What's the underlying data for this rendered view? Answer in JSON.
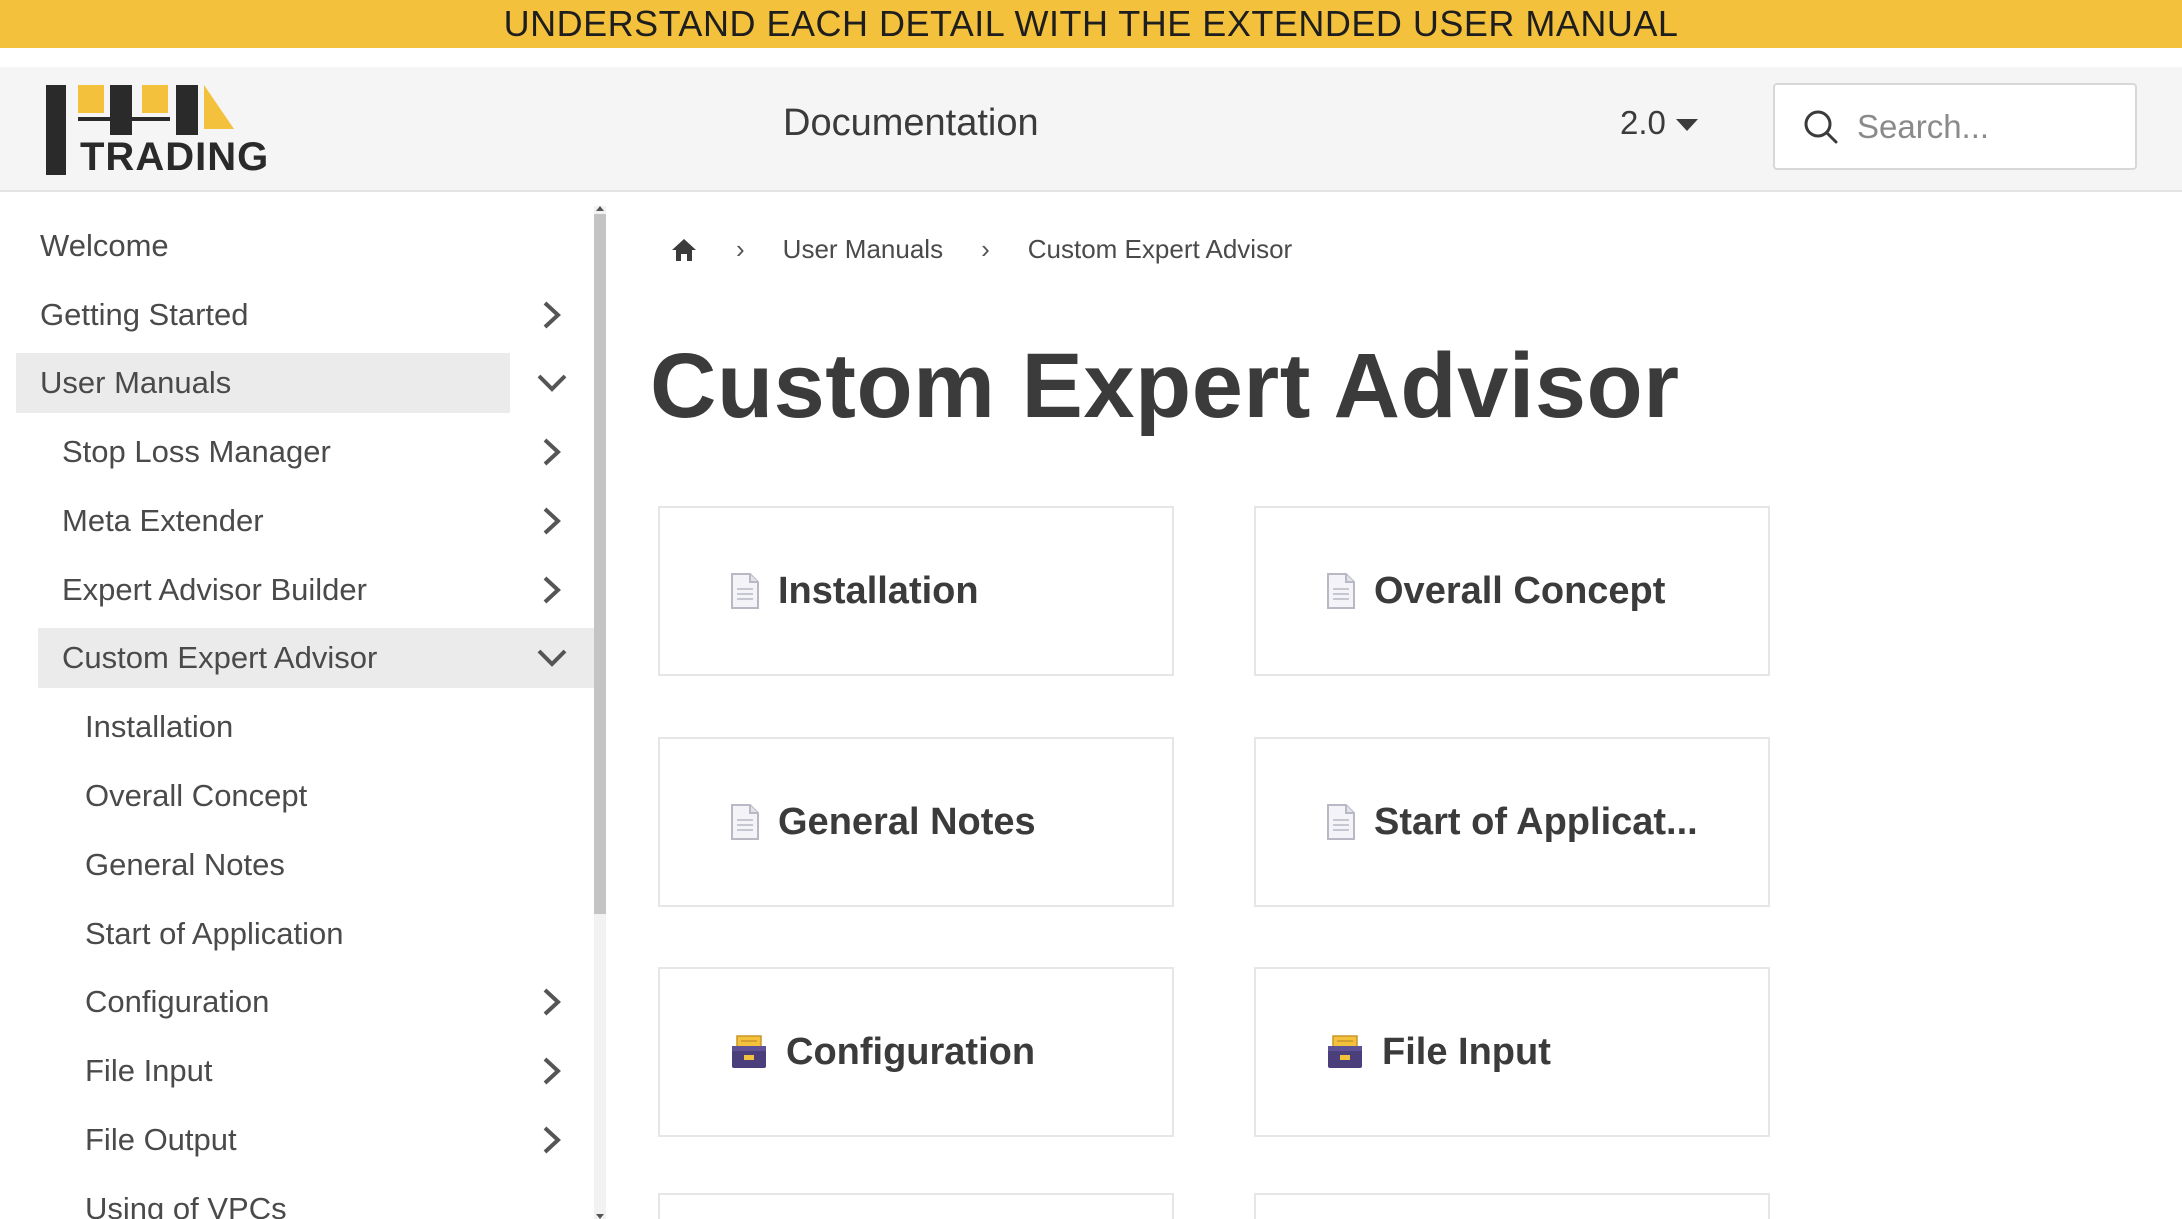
{
  "banner": {
    "text": "UNDERSTAND EACH DETAIL WITH THE EXTENDED USER MANUAL"
  },
  "navbar": {
    "logo_text": "TRADING",
    "doc_link": "Documentation",
    "version": "2.0",
    "search_placeholder": "Search..."
  },
  "sidebar": {
    "items": [
      {
        "label": "Welcome"
      },
      {
        "label": "Getting Started"
      },
      {
        "label": "User Manuals"
      },
      {
        "label": "Stop Loss Manager"
      },
      {
        "label": "Meta Extender"
      },
      {
        "label": "Expert Advisor Builder"
      },
      {
        "label": "Custom Expert Advisor"
      },
      {
        "label": "Installation"
      },
      {
        "label": "Overall Concept"
      },
      {
        "label": "General Notes"
      },
      {
        "label": "Start of Application"
      },
      {
        "label": "Configuration"
      },
      {
        "label": "File Input"
      },
      {
        "label": "File Output"
      },
      {
        "label": "Using of VPCs"
      }
    ]
  },
  "breadcrumb": {
    "level1": "User Manuals",
    "level2": "Custom Expert Advisor"
  },
  "page_title": "Custom Expert Advisor",
  "cards": [
    {
      "label": "Installation",
      "icon": "document-icon"
    },
    {
      "label": "Overall Concept",
      "icon": "document-icon"
    },
    {
      "label": "General Notes",
      "icon": "document-icon"
    },
    {
      "label": "Start of Applicat...",
      "icon": "document-icon"
    },
    {
      "label": "Configuration",
      "icon": "card-file-box-icon"
    },
    {
      "label": "File Input",
      "icon": "card-file-box-icon"
    }
  ],
  "colors": {
    "banner": "#f4c13d",
    "active_item": "#ebebeb",
    "text": "#3b3b3b"
  }
}
